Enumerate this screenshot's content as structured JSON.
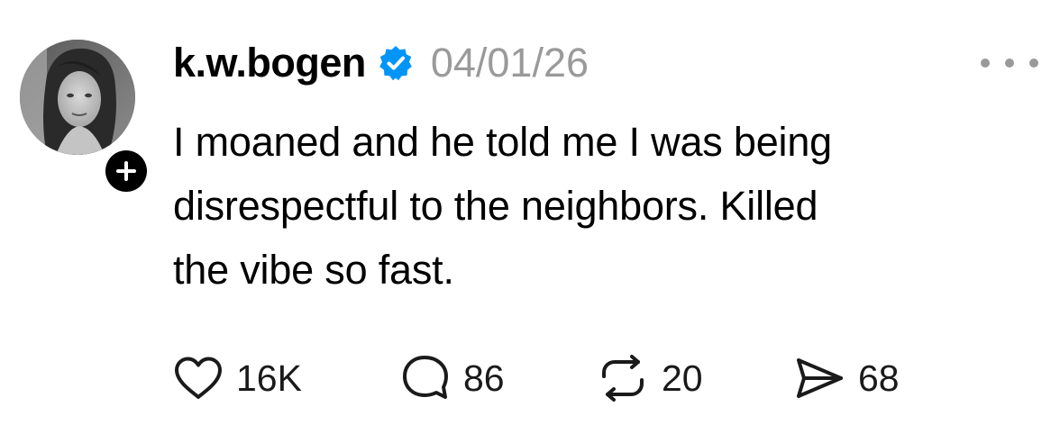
{
  "post": {
    "author": {
      "username": "k.w.bogen",
      "verified": true,
      "avatar_icon": "profile-photo",
      "follow_icon": "plus-icon"
    },
    "timestamp": "04/01/26",
    "more_icon": "ellipsis-icon",
    "text_lines": [
      "I moaned and he told me I was being",
      "disrespectful to the neighbors. Killed",
      "the vibe so fast."
    ],
    "actions": {
      "like": {
        "icon": "heart-icon",
        "count": "16K"
      },
      "reply": {
        "icon": "comment-icon",
        "count": "86"
      },
      "repost": {
        "icon": "repost-icon",
        "count": "20"
      },
      "share": {
        "icon": "send-icon",
        "count": "68"
      }
    }
  },
  "colors": {
    "text": "#000000",
    "muted": "#9a9a9a",
    "verified_blue": "#0095f6",
    "background": "#ffffff"
  }
}
